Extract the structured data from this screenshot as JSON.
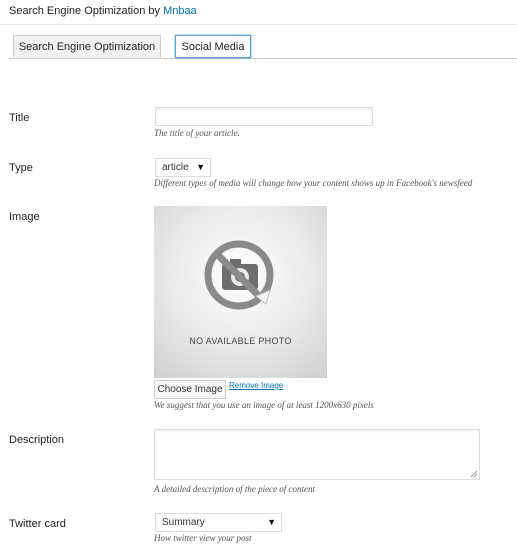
{
  "header": {
    "prefix": "Search Engine Optimization by",
    "brand": "Mnbaa"
  },
  "tabs": [
    {
      "label": "Search Engine Optimization"
    },
    {
      "label": "Social Media"
    }
  ],
  "fields": {
    "title": {
      "label": "Title",
      "value": "",
      "description": "The title of your article."
    },
    "type": {
      "label": "Type",
      "selected": "article",
      "description": "Different types of media will change how your content shows up in Facebook's newsfeed"
    },
    "image": {
      "label": "Image",
      "placeholder_text": "NO AVAILABLE PHOTO",
      "choose_button": "Choose Image",
      "remove_link": "Remove Image",
      "description": "We suggest that you use an image of at least 1200x630 pixels"
    },
    "description": {
      "label": "Description",
      "value": "",
      "description": "A detailed description of the piece of content"
    },
    "twitter_card": {
      "label": "Twitter card",
      "selected": "Summary",
      "description": "How twitter view your post"
    }
  },
  "icons": {
    "camera": "camera-off-icon",
    "dropdown": "triangle-down-icon",
    "resize": "resize-grip-icon"
  },
  "colors": {
    "link": "#0073aa",
    "focus_border": "#5b9dd9"
  }
}
